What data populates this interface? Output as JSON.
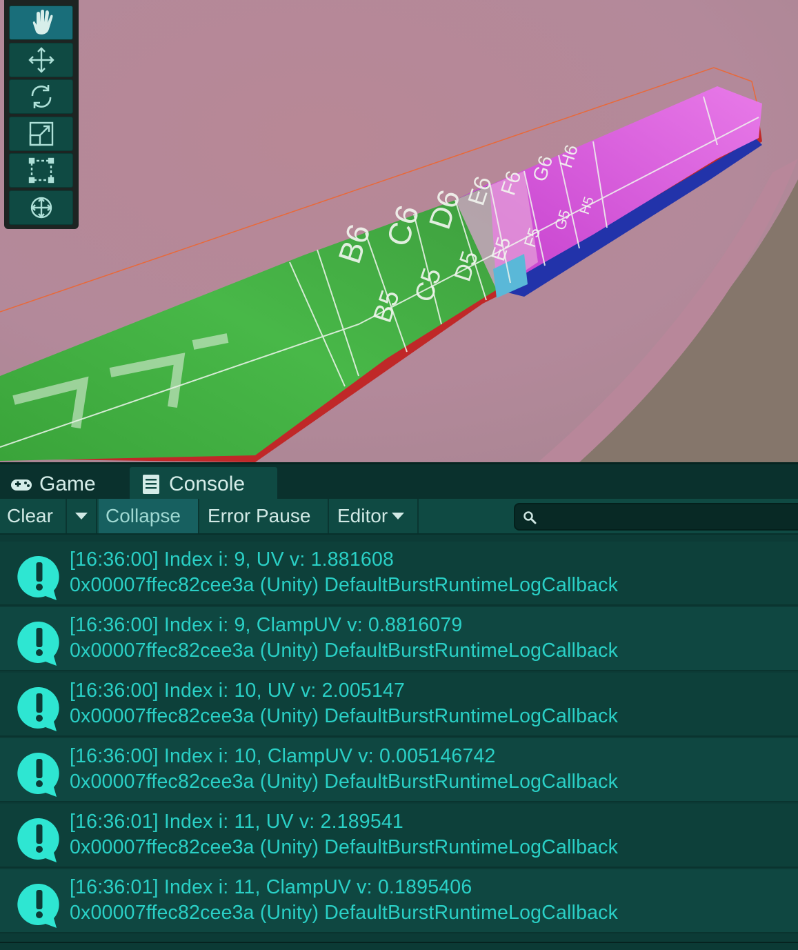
{
  "scene": {
    "tools": [
      {
        "name": "hand-tool",
        "icon": "hand-icon",
        "active": true
      },
      {
        "name": "move-tool",
        "icon": "move-icon",
        "active": false
      },
      {
        "name": "rotate-tool",
        "icon": "rotate-icon",
        "active": false
      },
      {
        "name": "scale-tool",
        "icon": "scale-icon",
        "active": false
      },
      {
        "name": "rect-tool",
        "icon": "rect-transform-icon",
        "active": false
      },
      {
        "name": "transform-tool",
        "icon": "transform-icon",
        "active": false
      }
    ],
    "cell_labels": [
      "B6",
      "C6",
      "D6",
      "E6",
      "F6",
      "G6",
      "H6",
      "B5",
      "C5",
      "D5",
      "E5",
      "F5",
      "G5",
      "H5"
    ]
  },
  "tabs": {
    "game_label": "Game",
    "console_label": "Console"
  },
  "console_toolbar": {
    "clear_label": "Clear",
    "collapse_label": "Collapse",
    "error_pause_label": "Error Pause",
    "editor_label": "Editor",
    "search_placeholder": ""
  },
  "logs": [
    {
      "line1": "[16:36:00] Index i: 9, UV v: 1.881608",
      "line2": "0x00007ffec82cee3a (Unity) DefaultBurstRuntimeLogCallback"
    },
    {
      "line1": "[16:36:00] Index i: 9, ClampUV v: 0.8816079",
      "line2": "0x00007ffec82cee3a (Unity) DefaultBurstRuntimeLogCallback"
    },
    {
      "line1": "[16:36:00] Index i: 10, UV v: 2.005147",
      "line2": "0x00007ffec82cee3a (Unity) DefaultBurstRuntimeLogCallback"
    },
    {
      "line1": "[16:36:00] Index i: 10, ClampUV v: 0.005146742",
      "line2": "0x00007ffec82cee3a (Unity) DefaultBurstRuntimeLogCallback"
    },
    {
      "line1": "[16:36:01] Index i: 11, UV v: 2.189541",
      "line2": "0x00007ffec82cee3a (Unity) DefaultBurstRuntimeLogCallback"
    },
    {
      "line1": "[16:36:01] Index i: 11, ClampUV v: 0.1895406",
      "line2": "0x00007ffec82cee3a (Unity) DefaultBurstRuntimeLogCallback"
    }
  ],
  "colors": {
    "log_text": "#2ad0c6",
    "log_icon": "#2ee6d2",
    "accent": "#176060"
  }
}
